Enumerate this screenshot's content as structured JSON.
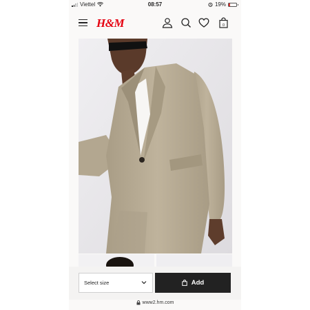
{
  "status_bar": {
    "carrier": "Viettel",
    "time": "08:57",
    "battery_percent": "19%",
    "battery_level": 0.19,
    "icons": [
      "signal-icon",
      "wifi-icon",
      "alarm-icon",
      "battery-icon"
    ]
  },
  "header": {
    "logo": "H&M",
    "icons": [
      "hamburger-menu-icon",
      "account-icon",
      "search-icon",
      "heart-icon",
      "bag-icon"
    ],
    "bag_count": "0"
  },
  "product": {
    "image": "blazer-model-photo",
    "thumbnails": [
      "model-hair-thumbnail",
      "blank-thumbnail"
    ]
  },
  "actions": {
    "size_select": "Select size",
    "add_button": "Add"
  },
  "browser": {
    "url": "www2.hm.com"
  },
  "colors": {
    "brand_red": "#e50010",
    "button_dark": "#222222",
    "blazer_beige": "#b8ab93",
    "battery_red": "#e0332f"
  }
}
